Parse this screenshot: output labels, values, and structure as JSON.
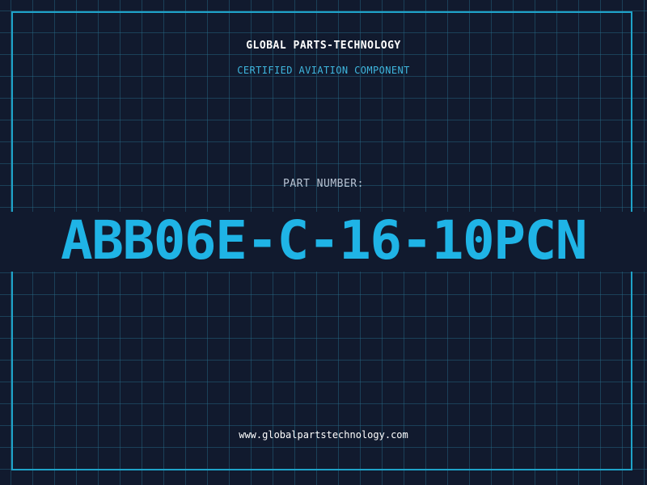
{
  "card": {
    "brand": "GLOBAL PARTS-TECHNOLOGY",
    "tagline": "CERTIFIED AVIATION COMPONENT",
    "part_label": "PART NUMBER:",
    "part_number": "ABB06E-C-16-10PCN",
    "website": "www.globalpartstechnology.com"
  },
  "colors": {
    "background": "#111a2e",
    "grid": "#286e8c",
    "frame": "#1fa3c9",
    "accent": "#1fb4e6"
  }
}
